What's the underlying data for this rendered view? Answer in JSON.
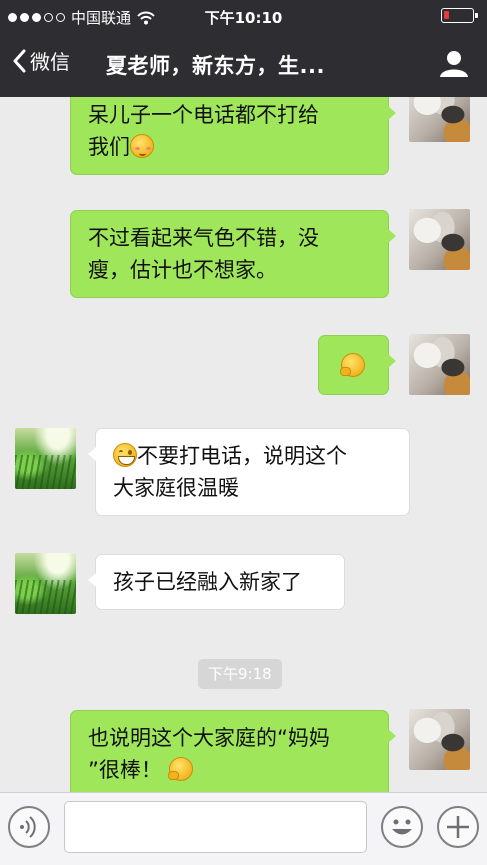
{
  "status_bar": {
    "carrier": "中国联通",
    "time": "下午10:10"
  },
  "nav": {
    "back_label": "微信",
    "title": "夏老师，新东方，生..."
  },
  "messages": [
    {
      "side": "me",
      "text_lines": [
        "呆儿子一个电话都不打给",
        "我们"
      ],
      "emoji": "blush-emoji"
    },
    {
      "side": "me",
      "text_lines": [
        "不过看起来气色不错，没",
        "瘦，估计也不想家。"
      ]
    },
    {
      "side": "me",
      "emoji_only": "thinking-emoji"
    },
    {
      "side": "other",
      "text_lines": [
        "不要打电话，说明这个",
        "大家庭很温暖"
      ],
      "emoji": "grin-emoji"
    },
    {
      "side": "other",
      "text_lines": [
        "孩子已经融入新家了"
      ]
    },
    {
      "side": "me",
      "text_lines": [
        "也说明这个大家庭的“妈妈",
        "”很棒！"
      ],
      "emoji": "thinking-emoji"
    }
  ],
  "timestamp": "下午9:18",
  "colors": {
    "nav_bg": "#2e2e32",
    "my_bubble": "#9fe65a",
    "their_bubble": "#ffffff",
    "chat_bg": "#ebebeb"
  }
}
